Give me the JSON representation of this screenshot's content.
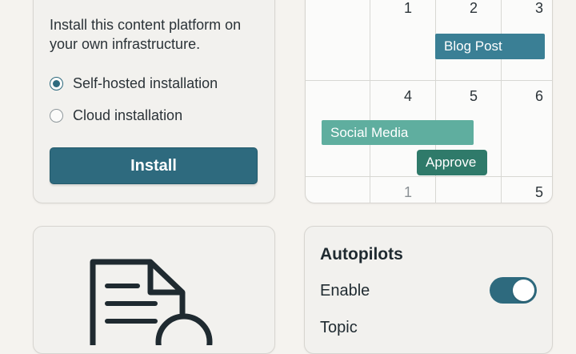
{
  "install": {
    "description": "Install this content platform on your own infrastructure.",
    "options": [
      {
        "label": "Self-hosted installation",
        "selected": true
      },
      {
        "label": "Cloud installation",
        "selected": false
      }
    ],
    "install_label": "Install"
  },
  "calendar": {
    "row1_days": [
      "1",
      "2",
      "3"
    ],
    "row2_days": [
      "4",
      "5",
      "6"
    ],
    "row3_days": [
      "1",
      "5"
    ],
    "events": [
      {
        "label": "Blog Post",
        "color": "#3a7f95"
      },
      {
        "label": "Social Media",
        "color": "#5fae9f"
      },
      {
        "label": "Approve",
        "color": "#2f7a6a"
      }
    ]
  },
  "document": {
    "icon": "document-search-icon"
  },
  "autopilots": {
    "title": "Autopilots",
    "enable_label": "Enable",
    "enabled": true,
    "topic_label": "Topic"
  },
  "colors": {
    "accent": "#2e6a7e",
    "background": "#f5f3ef",
    "card": "#f2f1ee"
  }
}
